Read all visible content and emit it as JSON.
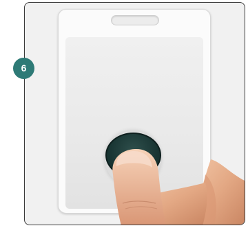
{
  "step": {
    "number": "6",
    "color": "#2e7a76"
  },
  "card": {
    "slot_icon": "lanyard-slot",
    "sensor_icon": "fingerprint-sensor"
  },
  "hand_icon": "finger-pressing-sensor"
}
